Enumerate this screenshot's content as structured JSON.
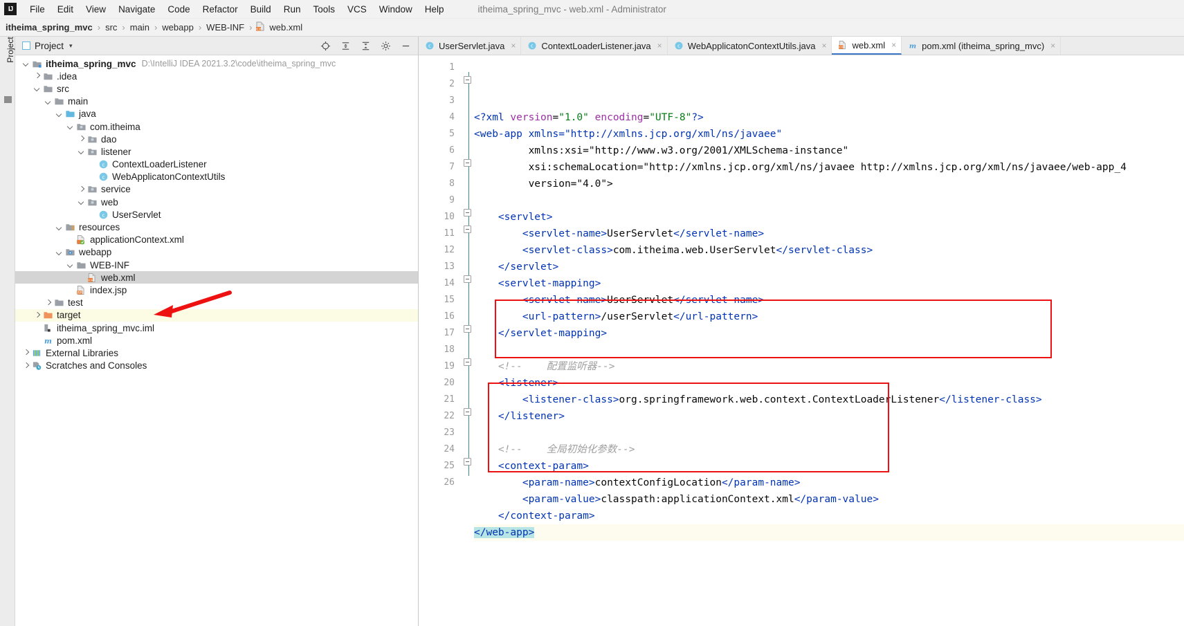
{
  "window": {
    "title": "itheima_spring_mvc - web.xml - Administrator",
    "logo": "intellij-idea-logo"
  },
  "menu": {
    "items": [
      "File",
      "Edit",
      "View",
      "Navigate",
      "Code",
      "Refactor",
      "Build",
      "Run",
      "Tools",
      "VCS",
      "Window",
      "Help"
    ]
  },
  "breadcrumb": {
    "items": [
      {
        "label": "itheima_spring_mvc",
        "bold": true,
        "icon": "none"
      },
      {
        "label": "src",
        "bold": false,
        "icon": "none"
      },
      {
        "label": "main",
        "bold": false,
        "icon": "none"
      },
      {
        "label": "webapp",
        "bold": false,
        "icon": "none"
      },
      {
        "label": "WEB-INF",
        "bold": false,
        "icon": "none"
      },
      {
        "label": "web.xml",
        "bold": false,
        "icon": "xml-file-icon"
      }
    ],
    "separator": "›"
  },
  "toolstrip": {
    "project_label": "Project"
  },
  "project_panel": {
    "title": "Project",
    "dropdown_caret": "▾",
    "actions": [
      "locate-icon",
      "expand-all-icon",
      "collapse-all-icon",
      "settings-icon",
      "hide-icon"
    ],
    "tree": [
      {
        "indent": 0,
        "arrow": "down",
        "icon": "module-icon",
        "label": "itheima_spring_mvc",
        "bold": true,
        "hint": "D:\\IntelliJ IDEA 2021.3.2\\code\\itheima_spring_mvc",
        "state": "normal"
      },
      {
        "indent": 1,
        "arrow": "right",
        "icon": "folder-icon",
        "label": ".idea",
        "bold": false,
        "hint": "",
        "state": "normal"
      },
      {
        "indent": 1,
        "arrow": "down",
        "icon": "folder-icon",
        "label": "src",
        "bold": false,
        "hint": "",
        "state": "normal"
      },
      {
        "indent": 2,
        "arrow": "down",
        "icon": "folder-icon",
        "label": "main",
        "bold": false,
        "hint": "",
        "state": "normal"
      },
      {
        "indent": 3,
        "arrow": "down",
        "icon": "source-root-icon",
        "label": "java",
        "bold": false,
        "hint": "",
        "state": "normal"
      },
      {
        "indent": 4,
        "arrow": "down",
        "icon": "package-icon",
        "label": "com.itheima",
        "bold": false,
        "hint": "",
        "state": "normal"
      },
      {
        "indent": 5,
        "arrow": "right",
        "icon": "package-icon",
        "label": "dao",
        "bold": false,
        "hint": "",
        "state": "normal"
      },
      {
        "indent": 5,
        "arrow": "down",
        "icon": "package-icon",
        "label": "listener",
        "bold": false,
        "hint": "",
        "state": "normal"
      },
      {
        "indent": 6,
        "arrow": "none",
        "icon": "java-class-icon",
        "label": "ContextLoaderListener",
        "bold": false,
        "hint": "",
        "state": "normal"
      },
      {
        "indent": 6,
        "arrow": "none",
        "icon": "java-class-icon",
        "label": "WebApplicatonContextUtils",
        "bold": false,
        "hint": "",
        "state": "normal"
      },
      {
        "indent": 5,
        "arrow": "right",
        "icon": "package-icon",
        "label": "service",
        "bold": false,
        "hint": "",
        "state": "normal"
      },
      {
        "indent": 5,
        "arrow": "down",
        "icon": "package-icon",
        "label": "web",
        "bold": false,
        "hint": "",
        "state": "normal"
      },
      {
        "indent": 6,
        "arrow": "none",
        "icon": "java-class-icon",
        "label": "UserServlet",
        "bold": false,
        "hint": "",
        "state": "normal"
      },
      {
        "indent": 3,
        "arrow": "down",
        "icon": "resource-root-icon",
        "label": "resources",
        "bold": false,
        "hint": "",
        "state": "normal"
      },
      {
        "indent": 4,
        "arrow": "none",
        "icon": "spring-xml-icon",
        "label": "applicationContext.xml",
        "bold": false,
        "hint": "",
        "state": "normal"
      },
      {
        "indent": 3,
        "arrow": "down",
        "icon": "webapp-root-icon",
        "label": "webapp",
        "bold": false,
        "hint": "",
        "state": "normal"
      },
      {
        "indent": 4,
        "arrow": "down",
        "icon": "folder-icon",
        "label": "WEB-INF",
        "bold": false,
        "hint": "",
        "state": "normal"
      },
      {
        "indent": 5,
        "arrow": "none",
        "icon": "xml-file-icon",
        "label": "web.xml",
        "bold": false,
        "hint": "",
        "state": "selected"
      },
      {
        "indent": 4,
        "arrow": "none",
        "icon": "jsp-file-icon",
        "label": "index.jsp",
        "bold": false,
        "hint": "",
        "state": "normal"
      },
      {
        "indent": 2,
        "arrow": "right",
        "icon": "folder-icon",
        "label": "test",
        "bold": false,
        "hint": "",
        "state": "normal"
      },
      {
        "indent": 1,
        "arrow": "right",
        "icon": "target-folder-icon",
        "label": "target",
        "bold": false,
        "hint": "",
        "state": "highlight"
      },
      {
        "indent": 1,
        "arrow": "none",
        "icon": "iml-file-icon",
        "label": "itheima_spring_mvc.iml",
        "bold": false,
        "hint": "",
        "state": "normal"
      },
      {
        "indent": 1,
        "arrow": "none",
        "icon": "maven-icon",
        "label": "pom.xml",
        "bold": false,
        "hint": "",
        "state": "normal"
      },
      {
        "indent": 0,
        "arrow": "right",
        "icon": "libraries-icon",
        "label": "External Libraries",
        "bold": false,
        "hint": "",
        "state": "normal"
      },
      {
        "indent": 0,
        "arrow": "right",
        "icon": "scratches-icon",
        "label": "Scratches and Consoles",
        "bold": false,
        "hint": "",
        "state": "normal"
      }
    ]
  },
  "editor": {
    "tabs": [
      {
        "label": "UserServlet.java",
        "icon": "java-class-icon",
        "active": false,
        "closable": true
      },
      {
        "label": "ContextLoaderListener.java",
        "icon": "java-class-icon",
        "active": false,
        "closable": true
      },
      {
        "label": "WebApplicatonContextUtils.java",
        "icon": "java-class-icon",
        "active": false,
        "closable": true
      },
      {
        "label": "web.xml",
        "icon": "xml-file-icon",
        "active": true,
        "closable": true
      },
      {
        "label": "pom.xml (itheima_spring_mvc)",
        "icon": "maven-icon",
        "active": false,
        "closable": true
      }
    ],
    "line_numbers": [
      1,
      2,
      3,
      4,
      5,
      6,
      7,
      8,
      9,
      10,
      11,
      12,
      13,
      14,
      15,
      16,
      17,
      18,
      19,
      20,
      21,
      22,
      23,
      24,
      25,
      26
    ],
    "code_lines": [
      "<?xml version=\"1.0\" encoding=\"UTF-8\"?>",
      "<web-app xmlns=\"http://xmlns.jcp.org/xml/ns/javaee\"",
      "         xmlns:xsi=\"http://www.w3.org/2001/XMLSchema-instance\"",
      "         xsi:schemaLocation=\"http://xmlns.jcp.org/xml/ns/javaee http://xmlns.jcp.org/xml/ns/javaee/web-app_4",
      "         version=\"4.0\">",
      "",
      "    <servlet>",
      "        <servlet-name>UserServlet</servlet-name>",
      "        <servlet-class>com.itheima.web.UserServlet</servlet-class>",
      "    </servlet>",
      "    <servlet-mapping>",
      "        <servlet-name>UserServlet</servlet-name>",
      "        <url-pattern>/userServlet</url-pattern>",
      "    </servlet-mapping>",
      "",
      "    <!--    配置监听器-->",
      "    <listener>",
      "        <listener-class>org.springframework.web.context.ContextLoaderListener</listener-class>",
      "    </listener>",
      "",
      "    <!--    全局初始化参数-->",
      "    <context-param>",
      "        <param-name>contextConfigLocation</param-name>",
      "        <param-value>classpath:applicationContext.xml</param-value>",
      "    </context-param>",
      "</web-app>"
    ],
    "annotations": {
      "red_box_1_label": "listener-config-highlight",
      "red_box_2_label": "context-param-highlight",
      "red_arrow_label": "web-xml-pointer-arrow"
    }
  },
  "colors": {
    "accent": "#3c78c8",
    "tag": "#0033b3",
    "attribute": "#9c2fa5",
    "string": "#067d17",
    "comment": "#a0a0a0",
    "annotation_red": "#ee1111",
    "selection": "#d4d4d4",
    "target_folder_highlight": "#fcfbe3"
  }
}
